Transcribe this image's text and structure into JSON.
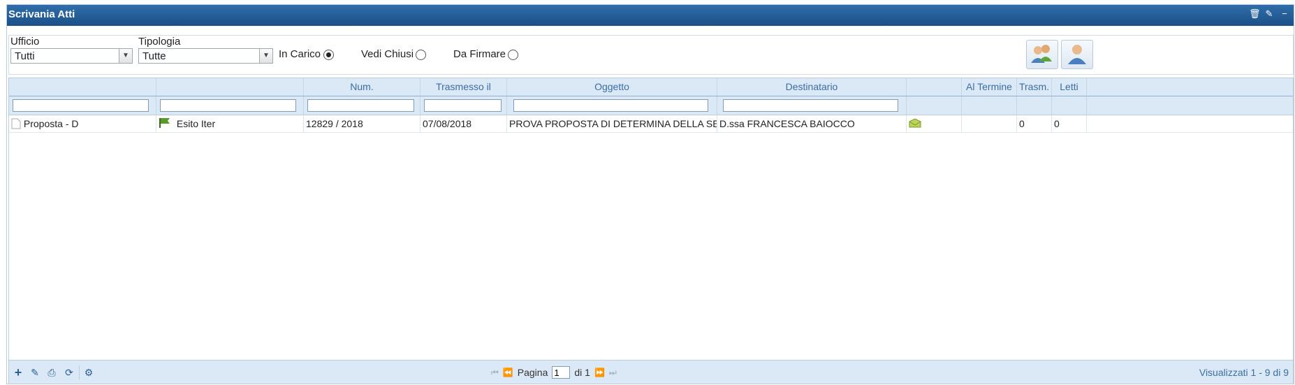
{
  "window": {
    "title": "Scrivania Atti"
  },
  "filters": {
    "ufficio": {
      "label": "Ufficio",
      "value": "Tutti"
    },
    "tipologia": {
      "label": "Tipologia",
      "value": "Tutte"
    },
    "radios": [
      {
        "label": "In Carico",
        "checked": true
      },
      {
        "label": "Vedi Chiusi",
        "checked": false
      },
      {
        "label": "Da Firmare",
        "checked": false
      }
    ]
  },
  "grid": {
    "columns": [
      "",
      "",
      "Num.",
      "Trasmesso il",
      "Oggetto",
      "Destinatario",
      "",
      "Al Termine",
      "Trasm.",
      "Letti"
    ],
    "rows": [
      {
        "tipo": "Proposta - D",
        "stato": "Esito Iter",
        "num": "12829 / 2018",
        "trasmesso": "07/08/2018",
        "oggetto": "PROVA PROPOSTA DI DETERMINA DELLA SEGRETERIA",
        "destinatario": "D.ssa FRANCESCA BAIOCCO",
        "al_termine": "",
        "trasm": "0",
        "letti": "0"
      }
    ]
  },
  "pager": {
    "page_label": "Pagina",
    "page": "1",
    "of_label": "di 1",
    "status": "Visualizzati 1 - 9 di 9"
  },
  "icons": {
    "title": [
      "trash-icon",
      "pencil-icon",
      "minimize-icon"
    ],
    "toolbar": [
      "users-group-icon",
      "user-icon"
    ],
    "footer": [
      "add-icon",
      "edit-icon",
      "print-icon",
      "refresh-icon",
      "settings-icon"
    ]
  },
  "colors": {
    "titlebar": "#1c4f86",
    "header": "#dbe8f6",
    "accent": "#3a6ea5",
    "flag": "#5a9a2a"
  }
}
